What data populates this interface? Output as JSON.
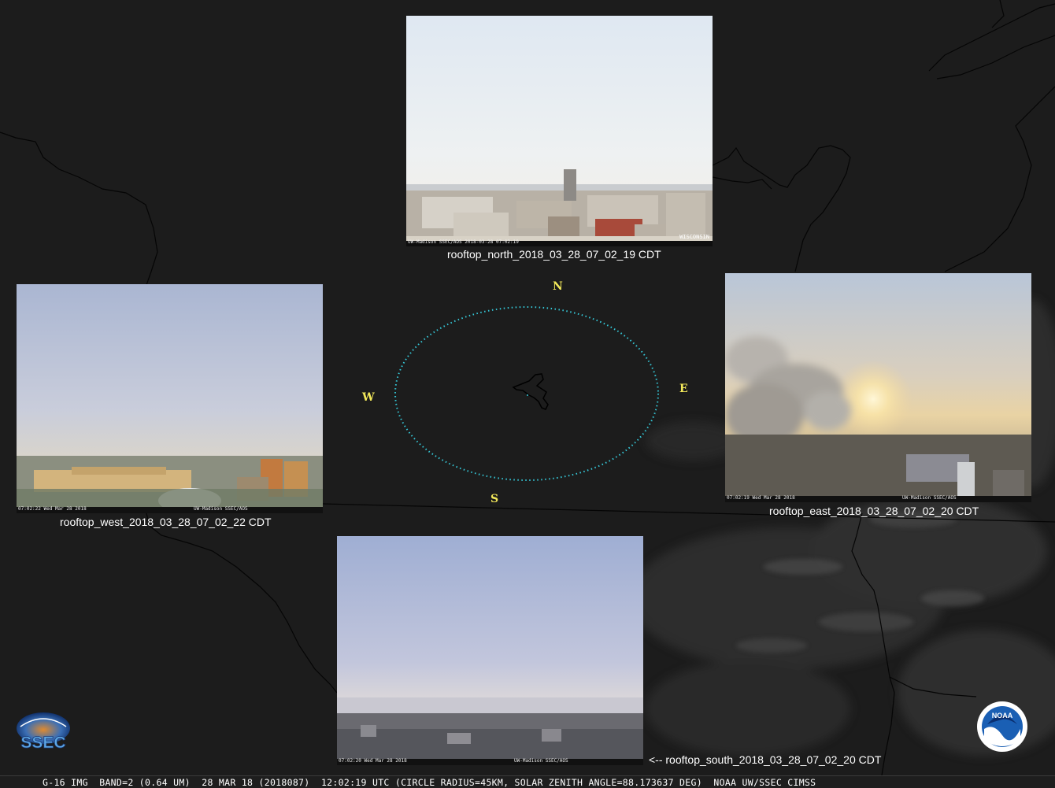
{
  "cameras": {
    "north": {
      "caption": "rooftop_north_2018_03_28_07_02_19 CDT",
      "stamp_left": "UW-Madison SSEC/AOS  2018-03-28 07:02:19",
      "stamp_right": "WISCONSIN"
    },
    "west": {
      "caption": "rooftop_west_2018_03_28_07_02_22 CDT",
      "stamp_left": "07:02:22 Wed Mar 28 2018",
      "stamp_right": "UW-Madison SSEC/AOS"
    },
    "east": {
      "caption": "rooftop_east_2018_03_28_07_02_20 CDT",
      "stamp_left": "07:02:19 Wed Mar 28 2018",
      "stamp_right": "UW-Madison SSEC/AOS"
    },
    "south": {
      "caption": "<-- rooftop_south_2018_03_28_07_02_20 CDT",
      "stamp_left": "07:02:20 Wed Mar 28 2018",
      "stamp_right": "UW-Madison SSEC/AOS"
    }
  },
  "compass": {
    "north": "N",
    "south": "S",
    "east": "E",
    "west": "W"
  },
  "logos": {
    "ssec": "SSEC",
    "noaa": "NOAA"
  },
  "status_bar": "G-16 IMG  BAND=2 (0.64 UM)  28 MAR 18 (2018087)  12:02:19 UTC (CIRCLE RADIUS=45KM, SOLAR ZENITH ANGLE=88.173637 DEG)  NOAA UW/SSEC CIMSS",
  "colors": {
    "background": "#1c1c1c",
    "border_lines": "#050505",
    "ellipse": "#35c8d8",
    "compass_text": "#f2e85a",
    "caption_text": "#ffffff"
  }
}
